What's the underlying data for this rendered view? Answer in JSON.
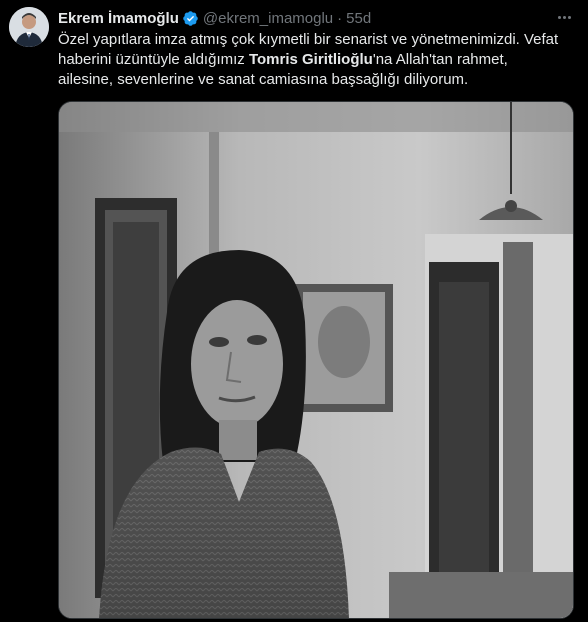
{
  "author": {
    "name": "Ekrem İmamoğlu",
    "handle": "@ekrem_imamoglu",
    "separator": "·",
    "time": "55d",
    "verified": true
  },
  "tweet": {
    "line1": "Özel yapıtlara imza atmış çok kıymetli bir senarist ve yönetmenimizdi. Vefat",
    "line2_before": "haberini üzüntüyle aldığımız ",
    "line2_bold": "Tomris Giritlioğlu",
    "line2_after": "'na Allah'tan rahmet,",
    "line3": "ailesine, sevenlerine ve sanat camiasına başsağlığı diliyorum."
  },
  "icons": {
    "verified": "verified-badge-icon",
    "more": "more-options-icon"
  },
  "colors": {
    "background": "#000000",
    "text": "#e7e9ea",
    "muted": "#71767b",
    "verified": "#1d9bf0"
  }
}
